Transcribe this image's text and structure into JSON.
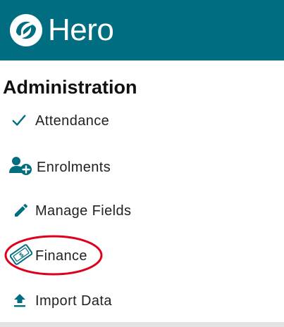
{
  "header": {
    "brand": "Hero",
    "logo_icon": "hero-swirl-logo",
    "background": "#006e80"
  },
  "section": {
    "title": "Administration"
  },
  "menu": {
    "items": [
      {
        "label": "Attendance",
        "icon": "check-icon"
      },
      {
        "label": "Enrolments",
        "icon": "person-add-icon"
      },
      {
        "label": "Manage Fields",
        "icon": "pencil-icon"
      },
      {
        "label": "Finance",
        "icon": "money-bill-icon"
      },
      {
        "label": "Import Data",
        "icon": "upload-icon"
      }
    ],
    "icon_color": "#006e80"
  },
  "annotation": {
    "highlighted_item": "Finance",
    "color": "#e0001b"
  }
}
